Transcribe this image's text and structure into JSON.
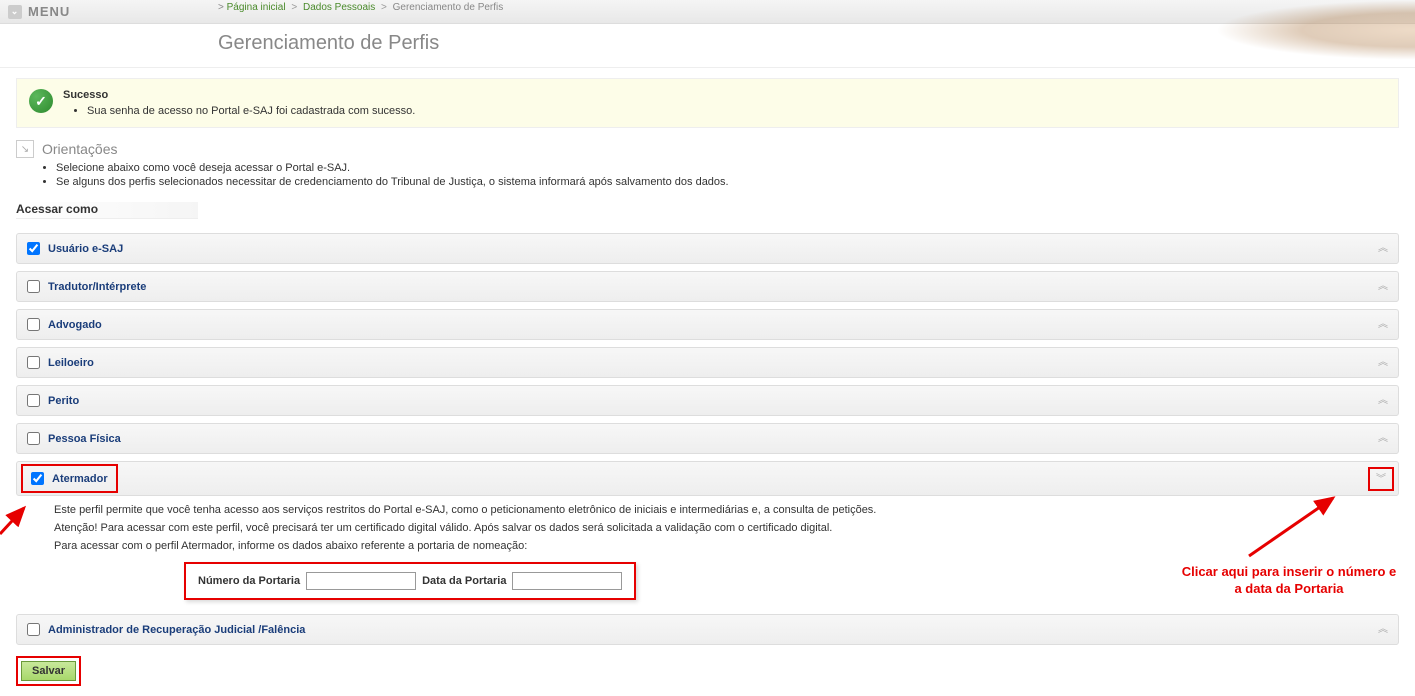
{
  "menu": {
    "label": "MENU"
  },
  "breadcrumb": {
    "items": [
      "Página inicial",
      "Dados Pessoais",
      "Gerenciamento de Perfis"
    ]
  },
  "page": {
    "title": "Gerenciamento de Perfis"
  },
  "success": {
    "title": "Sucesso",
    "items": [
      "Sua senha de acesso no Portal e-SAJ foi cadastrada com sucesso."
    ]
  },
  "orient": {
    "title": "Orientações",
    "items": [
      "Selecione abaixo como você deseja acessar o Portal e-SAJ.",
      "Se alguns dos perfis selecionados necessitar de credenciamento do Tribunal de Justiça, o sistema informará após salvamento dos dados."
    ]
  },
  "section": {
    "title": "Acessar como"
  },
  "profiles": [
    {
      "label": "Usuário e-SAJ",
      "checked": true,
      "expanded": false
    },
    {
      "label": "Tradutor/Intérprete",
      "checked": false,
      "expanded": false
    },
    {
      "label": "Advogado",
      "checked": false,
      "expanded": false
    },
    {
      "label": "Leiloeiro",
      "checked": false,
      "expanded": false
    },
    {
      "label": "Perito",
      "checked": false,
      "expanded": false
    },
    {
      "label": "Pessoa Física",
      "checked": false,
      "expanded": false
    },
    {
      "label": "Atermador",
      "checked": true,
      "expanded": true
    },
    {
      "label": "Administrador de Recuperação Judicial /Falência",
      "checked": false,
      "expanded": false
    }
  ],
  "atermador": {
    "p1": "Este perfil permite que você tenha acesso aos serviços restritos do Portal e-SAJ, como o peticionamento eletrônico de iniciais e intermediárias e, a consulta de petições.",
    "p2": "Atenção! Para acessar com este perfil, você precisará ter um certificado digital válido. Após salvar os dados será solicitada a validação com o certificado digital.",
    "p3": "Para acessar com o perfil Atermador, informe os dados abaixo referente a portaria de nomeação:",
    "num_label": "Número da Portaria",
    "date_label": "Data da Portaria"
  },
  "save": {
    "label": "Salvar"
  },
  "callout": {
    "text": "Clicar aqui para inserir o número e a data da Portaria"
  }
}
